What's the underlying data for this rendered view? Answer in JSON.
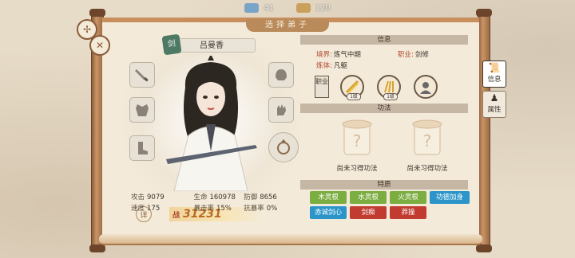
{
  "currency": [
    {
      "icon": "spirit-stone-icon",
      "value": "41"
    },
    {
      "icon": "jade-icon",
      "value": "120"
    }
  ],
  "title_tab": "选择弟子",
  "character": {
    "name": "吕曼香",
    "weapon_badge": "剑",
    "power_label": "战",
    "power_value": "31231",
    "detail_label": "详"
  },
  "stats": [
    [
      {
        "label": "攻击",
        "value": "9079"
      },
      {
        "label": "生命",
        "value": "160978"
      },
      {
        "label": "防御",
        "value": "8656"
      }
    ],
    [
      {
        "label": "速度",
        "value": "175"
      },
      {
        "label": "暴击率",
        "value": "15%"
      },
      {
        "label": "抗暴率",
        "value": "0%"
      }
    ]
  ],
  "info": {
    "header": "信息",
    "realm_label": "境界:",
    "realm_value": "炼气中期",
    "job_label": "职业:",
    "job_value": "剑修",
    "body_label": "炼体:",
    "body_value": "凡躯",
    "job_box": "职业",
    "skill_levels": [
      "1级",
      "1级"
    ]
  },
  "techniques": {
    "header": "功法",
    "slots": [
      "尚未习得功法",
      "尚未习得功法"
    ]
  },
  "traits": {
    "header": "特质",
    "items": [
      {
        "label": "木灵根",
        "color": "green"
      },
      {
        "label": "水灵根",
        "color": "green"
      },
      {
        "label": "火灵根",
        "color": "green"
      },
      {
        "label": "功德加身",
        "color": "blue"
      },
      {
        "label": "赤诚剑心",
        "color": "blue"
      },
      {
        "label": "剑痴",
        "color": "red"
      },
      {
        "label": "莽撞",
        "color": "red"
      }
    ]
  },
  "side_tabs": [
    {
      "label": "信息",
      "icon": "scroll-icon",
      "active": true
    },
    {
      "label": "属性",
      "icon": "character-icon",
      "active": false
    }
  ]
}
